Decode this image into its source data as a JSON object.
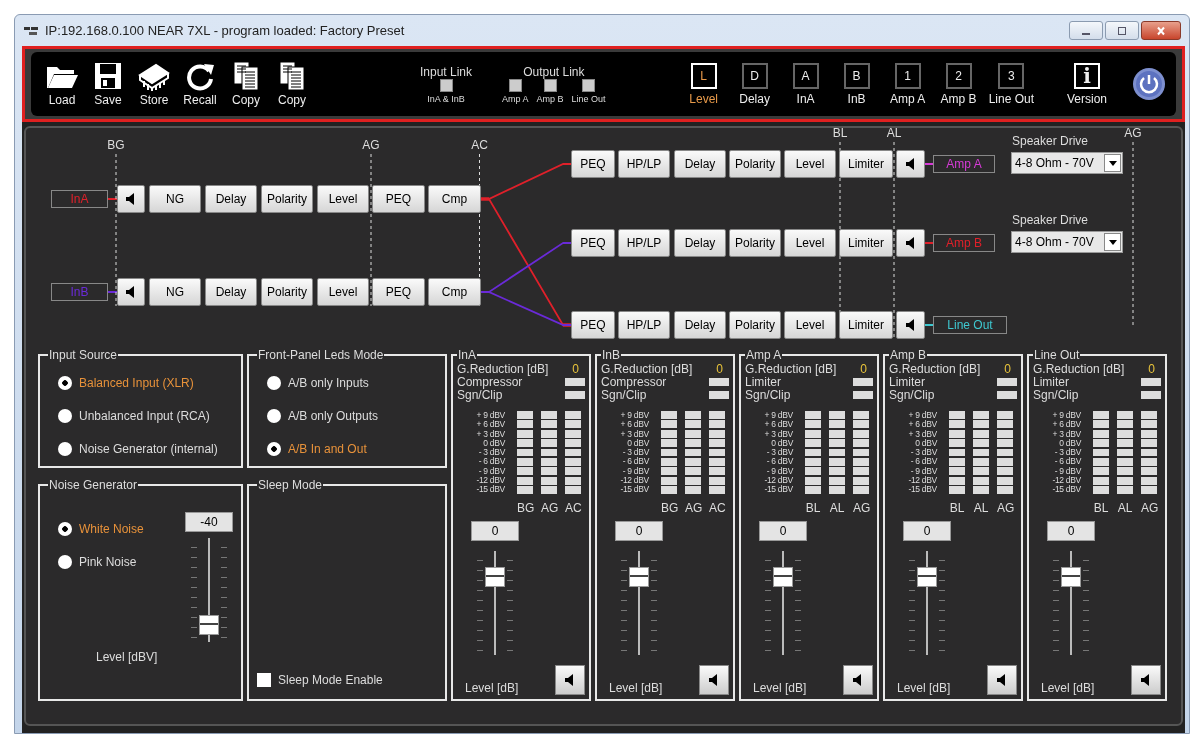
{
  "window": {
    "title": "IP:192.168.0.100  NEAR 7XL  - program loaded: Factory Preset"
  },
  "toolbar": {
    "actions": [
      {
        "label": "Load"
      },
      {
        "label": "Save"
      },
      {
        "label": "Store"
      },
      {
        "label": "Recall"
      },
      {
        "label": "Copy"
      },
      {
        "label": "Copy"
      }
    ],
    "input_link": {
      "title": "Input Link",
      "options": [
        {
          "label": "InA & InB",
          "checked": false
        }
      ]
    },
    "output_link": {
      "title": "Output Link",
      "options": [
        {
          "label": "Amp A",
          "checked": false
        },
        {
          "label": "Amp B",
          "checked": false
        },
        {
          "label": "Line Out",
          "checked": false
        }
      ]
    },
    "views": [
      {
        "letter": "L",
        "label": "Level",
        "selected": true
      },
      {
        "letter": "D",
        "label": "Delay",
        "selected": false
      },
      {
        "letter": "A",
        "label": "InA",
        "selected": false
      },
      {
        "letter": "B",
        "label": "InB",
        "selected": false
      },
      {
        "letter": "1",
        "label": "Amp A",
        "selected": false
      },
      {
        "letter": "2",
        "label": "Amp B",
        "selected": false
      },
      {
        "letter": "3",
        "label": "Line Out",
        "selected": false
      }
    ],
    "version": {
      "letter": "i",
      "label": "Version"
    }
  },
  "chain": {
    "input_markers": [
      "BG",
      "AG",
      "AC"
    ],
    "output_markers": [
      "BL",
      "AL",
      "AG"
    ],
    "inputs": [
      {
        "name": "InA",
        "color": "#e0202a",
        "blocks": [
          "NG",
          "Delay",
          "Polarity",
          "Level",
          "PEQ",
          "Cmp"
        ]
      },
      {
        "name": "InB",
        "color": "#6a2ad8",
        "blocks": [
          "NG",
          "Delay",
          "Polarity",
          "Level",
          "PEQ",
          "Cmp"
        ]
      }
    ],
    "outputs": [
      {
        "name": "Amp A",
        "color": "#d63ad6",
        "blocks": [
          "PEQ",
          "HP/LP",
          "Delay",
          "Polarity",
          "Level",
          "Limiter"
        ],
        "speaker_drive": {
          "label": "Speaker Drive",
          "value": "4-8 Ohm - 70V"
        }
      },
      {
        "name": "Amp B",
        "color": "#e0202a",
        "blocks": [
          "PEQ",
          "HP/LP",
          "Delay",
          "Polarity",
          "Level",
          "Limiter"
        ],
        "speaker_drive": {
          "label": "Speaker Drive",
          "value": "4-8 Ohm - 70V"
        }
      },
      {
        "name": "Line Out",
        "color": "#3ec8d0",
        "blocks": [
          "PEQ",
          "HP/LP",
          "Delay",
          "Polarity",
          "Level",
          "Limiter"
        ]
      }
    ]
  },
  "input_source": {
    "title": "Input Source",
    "options": [
      {
        "label": "Balanced Input (XLR)",
        "selected": true
      },
      {
        "label": "Unbalanced Input (RCA)",
        "selected": false
      },
      {
        "label": "Noise Generator (internal)",
        "selected": false
      }
    ]
  },
  "leds_mode": {
    "title": "Front-Panel Leds Mode",
    "options": [
      {
        "label": "A/B only Inputs",
        "selected": false
      },
      {
        "label": "A/B only Outputs",
        "selected": false
      },
      {
        "label": "A/B  In and Out",
        "selected": true
      }
    ]
  },
  "noise_generator": {
    "title": "Noise Generator",
    "options": [
      {
        "label": "White Noise",
        "selected": true
      },
      {
        "label": "Pink Noise",
        "selected": false
      }
    ],
    "value": "-40",
    "level": 0.08,
    "level_label": "Level [dBV]"
  },
  "sleep_mode": {
    "title": "Sleep Mode",
    "checkbox": {
      "label": "Sleep Mode Enable",
      "checked": false
    }
  },
  "channels": [
    {
      "title": "InA",
      "gr_label": "G.Reduction [dB]",
      "gr_value": "0",
      "leds": [
        "Compressor",
        "Sgn/Clip"
      ],
      "scale": [
        "+ 9 dBV",
        "+ 6 dBV",
        "+ 3 dBV",
        "0 dBV",
        "- 3 dBV",
        "- 6 dBV",
        "- 9 dBV",
        "-12 dBV",
        "-15 dBV"
      ],
      "meters": [
        "BG",
        "AG",
        "AC"
      ],
      "value": "0",
      "level": 0.8,
      "level_label": "Level [dB]"
    },
    {
      "title": "InB",
      "gr_label": "G.Reduction [dB]",
      "gr_value": "0",
      "leds": [
        "Compressor",
        "Sgn/Clip"
      ],
      "scale": [
        "+ 9 dBV",
        "+ 6 dBV",
        "+ 3 dBV",
        "0 dBV",
        "- 3 dBV",
        "- 6 dBV",
        "- 9 dBV",
        "-12 dBV",
        "-15 dBV"
      ],
      "meters": [
        "BG",
        "AG",
        "AC"
      ],
      "value": "0",
      "level": 0.8,
      "level_label": "Level [dB]"
    },
    {
      "title": "Amp A",
      "gr_label": "G.Reduction [dB]",
      "gr_value": "0",
      "leds": [
        "Limiter",
        "Sgn/Clip"
      ],
      "scale": [
        "+ 9 dBV",
        "+ 6 dBV",
        "+ 3 dBV",
        "0 dBV",
        "- 3 dBV",
        "- 6 dBV",
        "- 9 dBV",
        "-12 dBV",
        "-15 dBV"
      ],
      "meters": [
        "BL",
        "AL",
        "AG"
      ],
      "value": "0",
      "level": 0.8,
      "level_label": "Level [dB]"
    },
    {
      "title": "Amp B",
      "gr_label": "G.Reduction [dB]",
      "gr_value": "0",
      "leds": [
        "Limiter",
        "Sgn/Clip"
      ],
      "scale": [
        "+ 9 dBV",
        "+ 6 dBV",
        "+ 3 dBV",
        "0 dBV",
        "- 3 dBV",
        "- 6 dBV",
        "- 9 dBV",
        "-12 dBV",
        "-15 dBV"
      ],
      "meters": [
        "BL",
        "AL",
        "AG"
      ],
      "value": "0",
      "level": 0.8,
      "level_label": "Level [dB]"
    },
    {
      "title": "Line Out",
      "gr_label": "G.Reduction [dB]",
      "gr_value": "0",
      "leds": [
        "Limiter",
        "Sgn/Clip"
      ],
      "scale": [
        "+ 9 dBV",
        "+ 6 dBV",
        "+ 3 dBV",
        "0 dBV",
        "- 3 dBV",
        "- 6 dBV",
        "- 9 dBV",
        "-12 dBV",
        "-15 dBV"
      ],
      "meters": [
        "BL",
        "AL",
        "AG"
      ],
      "value": "0",
      "level": 0.8,
      "level_label": "Level [dB]"
    }
  ]
}
